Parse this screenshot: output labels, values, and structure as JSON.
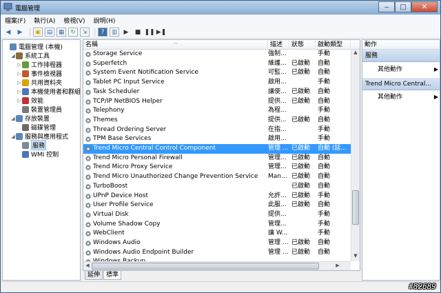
{
  "window": {
    "title": "電腦管理"
  },
  "menu": [
    "檔案(F)",
    "執行(A)",
    "檢視(V)",
    "說明(H)"
  ],
  "toolbar": {
    "buttons": [
      "back-icon",
      "forward-icon",
      "up-folder-icon",
      "show-tree-icon",
      "properties-icon",
      "refresh-icon",
      "export-icon",
      "help-icon",
      "show-hide-icon",
      "play-icon",
      "stop-icon",
      "pause-icon",
      "restart-icon"
    ]
  },
  "tree": [
    {
      "label": "電腦管理 (本機)",
      "indent": 0,
      "exp": "",
      "icon": "computer-icon"
    },
    {
      "label": "系統工具",
      "indent": 1,
      "exp": "◢",
      "icon": "tools-icon"
    },
    {
      "label": "工作排程器",
      "indent": 2,
      "exp": "▷",
      "icon": "clock-icon"
    },
    {
      "label": "事件檢視器",
      "indent": 2,
      "exp": "▷",
      "icon": "event-viewer-icon"
    },
    {
      "label": "共用資料夾",
      "indent": 2,
      "exp": "▷",
      "icon": "shared-folder-icon"
    },
    {
      "label": "本機使用者和群組",
      "indent": 2,
      "exp": "▷",
      "icon": "users-icon"
    },
    {
      "label": "效能",
      "indent": 2,
      "exp": "▷",
      "icon": "performance-icon"
    },
    {
      "label": "裝置管理員",
      "indent": 2,
      "exp": "",
      "icon": "device-manager-icon"
    },
    {
      "label": "存放裝置",
      "indent": 1,
      "exp": "◢",
      "icon": "storage-icon"
    },
    {
      "label": "磁碟管理",
      "indent": 2,
      "exp": "",
      "icon": "disk-icon"
    },
    {
      "label": "服務與應用程式",
      "indent": 1,
      "exp": "◢",
      "icon": "services-apps-icon"
    },
    {
      "label": "服務",
      "indent": 2,
      "exp": "",
      "icon": "services-icon",
      "selected": true
    },
    {
      "label": "WMI 控制",
      "indent": 2,
      "exp": "",
      "icon": "wmi-icon"
    }
  ],
  "columns": {
    "name": "名稱",
    "desc": "描述",
    "status": "狀態",
    "startup": "啟動類型"
  },
  "services": [
    {
      "name": "Storage Service",
      "desc": "強制...",
      "status": "",
      "startup": "手動"
    },
    {
      "name": "Superfetch",
      "desc": "維護...",
      "status": "已啟動",
      "startup": "自動"
    },
    {
      "name": "System Event Notification Service",
      "desc": "可監...",
      "status": "已啟動",
      "startup": "自動"
    },
    {
      "name": "Tablet PC Input Service",
      "desc": "啟用...",
      "status": "",
      "startup": "手動"
    },
    {
      "name": "Task Scheduler",
      "desc": "讓使...",
      "status": "已啟動",
      "startup": "自動"
    },
    {
      "name": "TCP/IP NetBIOS Helper",
      "desc": "提供...",
      "status": "已啟動",
      "startup": "自動"
    },
    {
      "name": "Telephony",
      "desc": "為程...",
      "status": "",
      "startup": "手動"
    },
    {
      "name": "Themes",
      "desc": "提供...",
      "status": "已啟動",
      "startup": "自動"
    },
    {
      "name": "Thread Ordering Server",
      "desc": "在指...",
      "status": "",
      "startup": "手動"
    },
    {
      "name": "TPM Base Services",
      "desc": "啟用...",
      "status": "",
      "startup": "手動"
    },
    {
      "name": "Trend Micro Central Control Component",
      "desc": "管理 ...",
      "status": "已啟動",
      "startup": "自動 (延...",
      "selected": true
    },
    {
      "name": "Trend Micro Personal Firewall",
      "desc": "管理...",
      "status": "已啟動",
      "startup": "自動"
    },
    {
      "name": "Trend Micro Proxy Service",
      "desc": "管理...",
      "status": "已啟動",
      "startup": "自動"
    },
    {
      "name": "Trend Micro Unauthorized Change Prevention Service",
      "desc": "Man...",
      "status": "已啟動",
      "startup": "自動"
    },
    {
      "name": "TurboBoost",
      "desc": "",
      "status": "已啟動",
      "startup": "自動"
    },
    {
      "name": "UPnP Device Host",
      "desc": "允許...",
      "status": "已啟動",
      "startup": "手動"
    },
    {
      "name": "User Profile Service",
      "desc": "此服...",
      "status": "已啟動",
      "startup": "自動"
    },
    {
      "name": "Virtual Disk",
      "desc": "提供...",
      "status": "",
      "startup": "手動"
    },
    {
      "name": "Volume Shadow Copy",
      "desc": "管理...",
      "status": "",
      "startup": "手動"
    },
    {
      "name": "WebClient",
      "desc": "讓 W...",
      "status": "",
      "startup": "手動"
    },
    {
      "name": "Windows Audio",
      "desc": "管理 ...",
      "status": "已啟動",
      "startup": "自動"
    },
    {
      "name": "Windows Audio Endpoint Builder",
      "desc": "管理 ...",
      "status": "已啟動",
      "startup": "自動"
    },
    {
      "name": "Windows Backup",
      "desc": "",
      "status": "",
      "startup": ""
    }
  ],
  "tabs": [
    "延伸",
    "標準"
  ],
  "actions": {
    "title": "動作",
    "sections": [
      {
        "title": "服務",
        "item": "其他動作"
      },
      {
        "title": "Trend Micro Central...",
        "item": "其他動作"
      }
    ]
  },
  "watermark": "#82689",
  "colors": {
    "selection": "#3399ff",
    "title_bar": "#8fb2d8"
  }
}
